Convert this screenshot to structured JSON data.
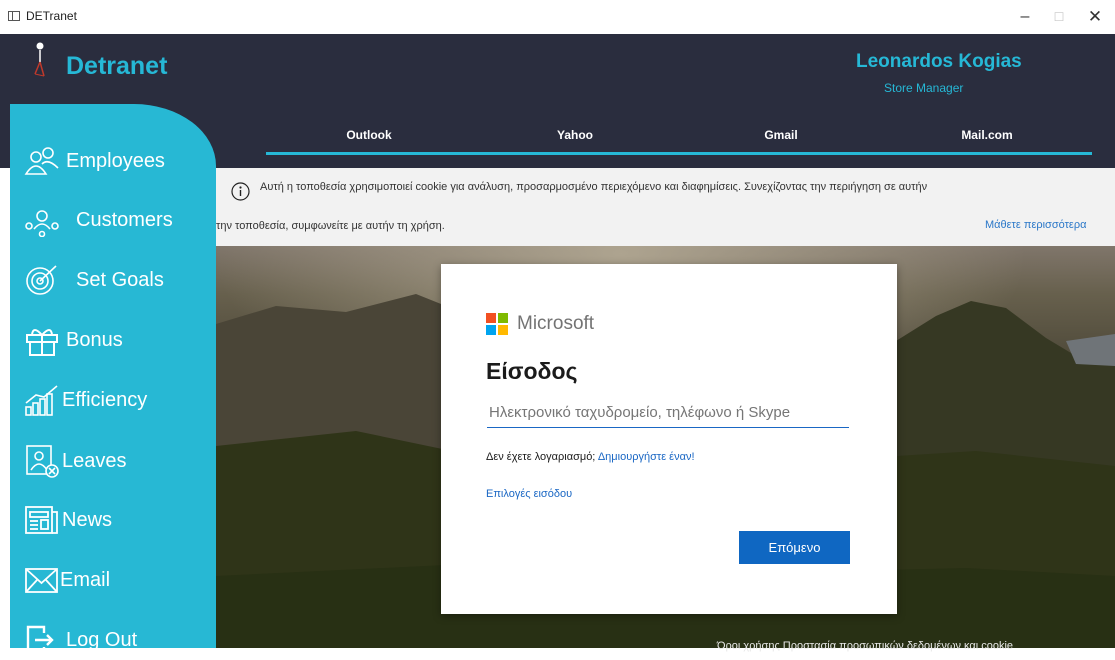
{
  "window": {
    "title": "DETranet",
    "minimize": "–",
    "maximize": "☐",
    "close": "✕"
  },
  "app": {
    "brand": "Detranet"
  },
  "user": {
    "name": "Leonardos Kogias",
    "role": "Store Manager"
  },
  "tabs": [
    {
      "label": "Outlook"
    },
    {
      "label": "Yahoo"
    },
    {
      "label": "Gmail"
    },
    {
      "label": "Mail.com"
    }
  ],
  "sidebar": {
    "items": [
      {
        "label": "Employees",
        "icon": "people-icon"
      },
      {
        "label": "Customers",
        "icon": "customers-icon"
      },
      {
        "label": "Set Goals",
        "icon": "target-icon"
      },
      {
        "label": "Bonus",
        "icon": "gift-icon"
      },
      {
        "label": "Efficiency",
        "icon": "chart-icon"
      },
      {
        "label": "Leaves",
        "icon": "leaves-icon"
      },
      {
        "label": "News",
        "icon": "newspaper-icon"
      },
      {
        "label": "Email",
        "icon": "envelope-icon"
      },
      {
        "label": "Log Out",
        "icon": "logout-icon"
      }
    ]
  },
  "cookie": {
    "line1": "Αυτή η τοποθεσία χρησιμοποιεί cookie για ανάλυση, προσαρμοσμένο περιεχόμενο και διαφημίσεις. Συνεχίζοντας την περιήγηση σε αυτήν",
    "line2": "την τοποθεσία, συμφωνείτε με αυτήν τη χρήση.",
    "learn_more": "Μάθετε περισσότερα"
  },
  "signin": {
    "brand": "Microsoft",
    "title": "Είσοδος",
    "email_placeholder": "Ηλεκτρονικό ταχυδρομείο, τηλέφωνο ή Skype",
    "email_value": "",
    "no_account": "Δεν έχετε λογαριασμό;",
    "create_link": "Δημιουργήστε έναν!",
    "options": "Επιλογές εισόδου",
    "next": "Επόμενο"
  },
  "footer": {
    "text": "Όροι χρήσης   Προστασία προσωπικών δεδομένων και cookie"
  },
  "colors": {
    "accent": "#26b8d6",
    "sidebar": "#27b8d4",
    "topbar": "#2a2d3e",
    "ms_blue": "#0f67c2"
  }
}
